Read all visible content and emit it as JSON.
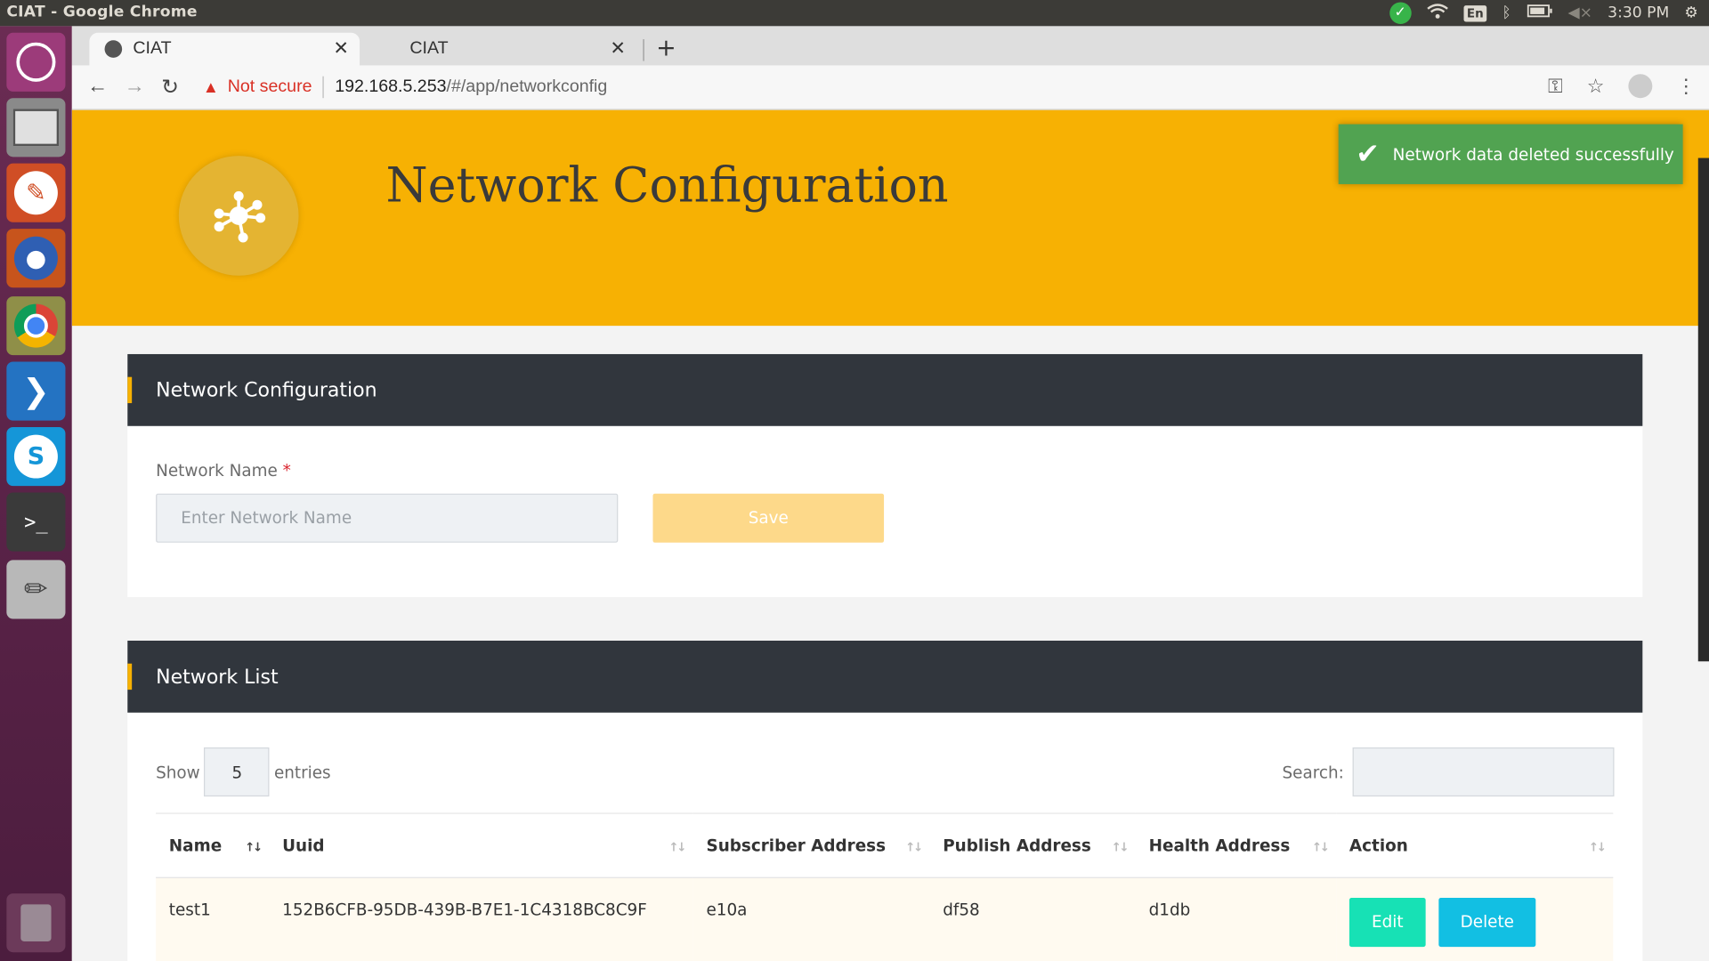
{
  "os": {
    "window_title": "CIAT - Google Chrome",
    "keyboard": "En",
    "clock": "3:30 PM"
  },
  "browser": {
    "tabs": [
      {
        "label": "CIAT",
        "active": true
      },
      {
        "label": "CIAT",
        "active": false
      }
    ],
    "security_label": "Not secure",
    "url_host": "192.168.5.253",
    "url_path": "/#/app/networkconfig"
  },
  "page": {
    "header_title": "Network Configuration",
    "toast_message": "Network data deleted successfully",
    "config_card": {
      "title": "Network Configuration",
      "field_label": "Network Name",
      "required_mark": "*",
      "field_placeholder": "Enter Network Name",
      "save_label": "Save"
    },
    "list_card": {
      "title": "Network List",
      "show_label": "Show",
      "entries_value": "5",
      "entries_label": "entries",
      "search_label": "Search:",
      "columns": [
        "Name",
        "Uuid",
        "Subscriber Address",
        "Publish Address",
        "Health Address",
        "Action"
      ],
      "rows": [
        {
          "name": "test1",
          "uuid": "152B6CFB-95DB-439B-B7E1-1C4318BC8C9F",
          "subscriber": "e10a",
          "publish": "df58",
          "health": "d1db",
          "edit_label": "Edit",
          "delete_label": "Delete"
        }
      ]
    }
  },
  "colors": {
    "header_bg": "#f7b103",
    "card_head": "#31363d",
    "toast": "#51a351",
    "edit": "#17e1b5",
    "delete": "#12bfe3"
  }
}
